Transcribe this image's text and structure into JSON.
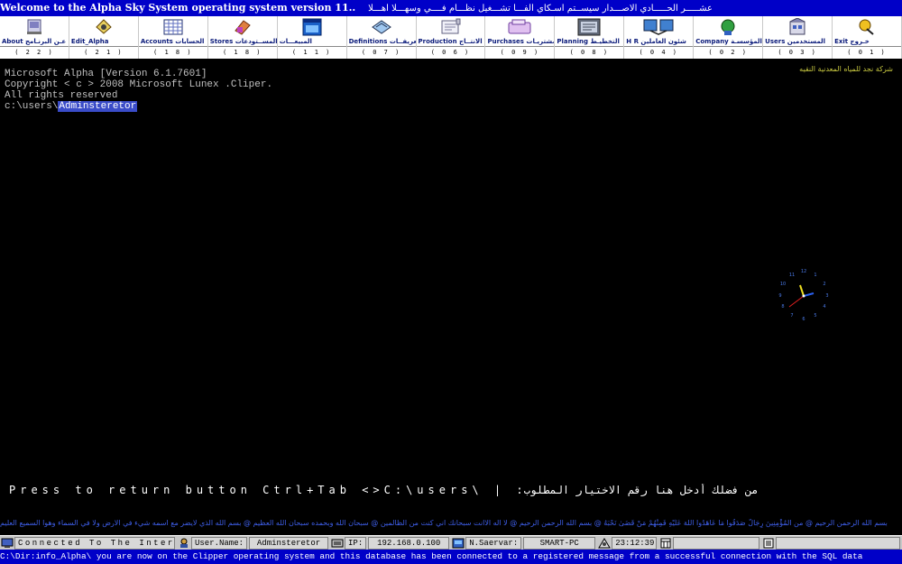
{
  "title_bar": {
    "text_en": "Welcome to the Alpha Sky System operating system version 11..",
    "text_ar": "عشـــــر الحـــــادي الاصـــدار سيســتم اسـكاي الفـــا تشـــغيل نظـــام فــــي وسهـــلا اهـــلا"
  },
  "toolbar": [
    {
      "label": "About عـن البرنـامج",
      "code": "( 2 2 )",
      "icon": "about-icon"
    },
    {
      "label": "Edit_Alpha",
      "code": "( 2 1 )",
      "icon": "edit-alpha-icon"
    },
    {
      "label": "Accounts الحسابات",
      "code": "( 1 8 )",
      "icon": "accounts-icon"
    },
    {
      "label": "Stores المســتودعات",
      "code": "( 1 8 )",
      "icon": "stores-icon"
    },
    {
      "label": "المبيعـــات",
      "code": "( 1 1 )",
      "icon": "sales-icon"
    },
    {
      "label": "Definitions التعريفــات",
      "code": "( 0 7 )",
      "icon": "definitions-icon"
    },
    {
      "label": "Production الانتــاج",
      "code": "( 0 6 )",
      "icon": "production-icon"
    },
    {
      "label": "Purchases المشتريـات",
      "code": "( 0 9 )",
      "icon": "purchases-icon"
    },
    {
      "label": "Planning التخطيـط",
      "code": "( 0 8 )",
      "icon": "planning-icon"
    },
    {
      "label": "H R شئون العاملين",
      "code": "( 0 4 )",
      "icon": "hr-icon"
    },
    {
      "label": "Company المؤسسـة",
      "code": "( 0 2 )",
      "icon": "company-icon"
    },
    {
      "label": "Users المستخدمين",
      "code": "( 0 3 )",
      "icon": "users-icon"
    },
    {
      "label": "Exit خـروج",
      "code": "( 0 1 )",
      "icon": "exit-icon"
    }
  ],
  "company_name": "شركة نجد للمياه المعدنية النقيه",
  "console": {
    "line1": "Microsoft Alpha [Version 6.1.7601]",
    "line2": "Copyright < c > 2008 Microsoft Lunex .Cliper.",
    "line3": "All rights reserved",
    "path": "c:\\users\\",
    "user": "Adminsteretor"
  },
  "prompt": {
    "text_en": "Press to return button Ctrl+Tab <>C:\\users\\  |",
    "text_ar": ":من فضلك أدخل هنا رقم الاختيار المطلوب"
  },
  "ticker": "بسم الله الرحمن الرحيم @ من الْمُؤْمِنِينَ رِجَالٌ صَدَقُوا مَا عَاهَدُوا اللَّهَ عَلَيْهِ فَمِنْهُمْ مَنْ قَضَىٰ نَحْبَهُ @ بسم الله الرحمن الرحيم @ لا اله الاانت سبحانك اني كنت من الظالمين @ سبحان الله وبحمده سبحان الله العظيم @ بسم الله الذي لايضر مع اسمه شيء في الارض ولا في السماء وهوا السميع العليم",
  "status_bar": {
    "connection": "Connected To The Internet",
    "user_label": "User.Name:",
    "user_value": "Adminsteretor",
    "ip_label": "IP:",
    "ip_value": "192.168.0.100",
    "server_label": "N.Saervar:",
    "server_value": "SMART-PC",
    "time": "23:12:39"
  },
  "message_bar": "C:\\Dir:info_Alpha\\ you are now on the Clipper operating system and this database has been connected to a registered message from a successful connection with the SQL data",
  "colors": {
    "title_bg": "#0000c8",
    "selection": "#3a4cc8",
    "company": "#c8c840",
    "ticker": "#3e5ee8"
  }
}
